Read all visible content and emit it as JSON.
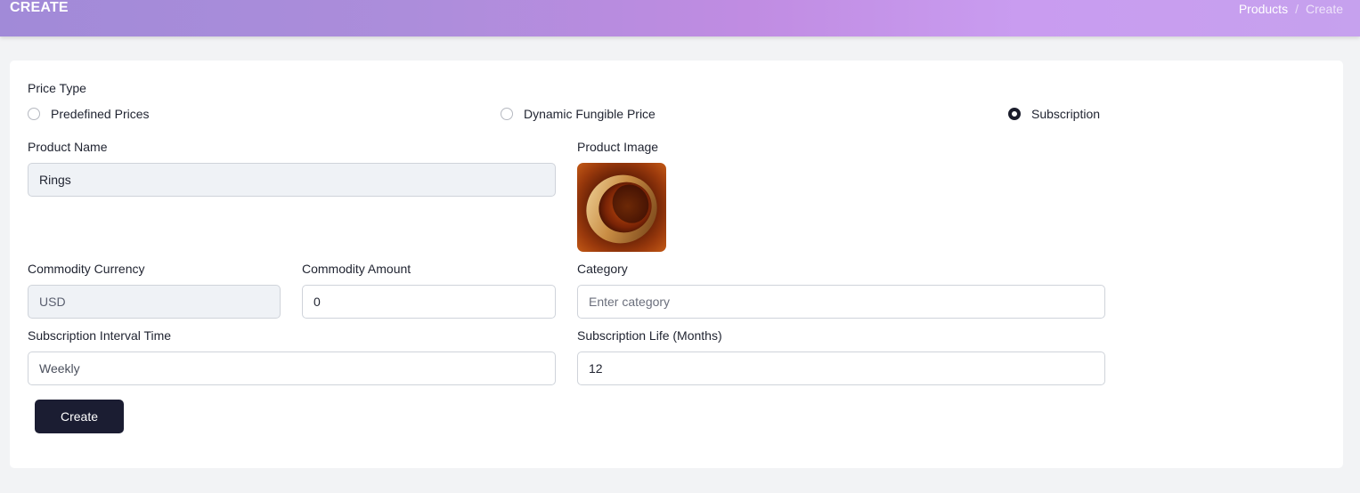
{
  "header": {
    "title": "CREATE",
    "breadcrumb": [
      "Products",
      "/",
      "Create"
    ]
  },
  "form": {
    "price_type": {
      "label": "Price Type",
      "options": [
        "Predefined Prices",
        "Dynamic Fungible Price",
        "Subscription"
      ],
      "selected": "Subscription"
    },
    "product_name": {
      "label": "Product Name",
      "value": "Rings"
    },
    "product_image": {
      "label": "Product Image",
      "icon": "ring-image"
    },
    "commodity_currency": {
      "label": "Commodity Currency",
      "value": "USD"
    },
    "commodity_amount": {
      "label": "Commodity Amount",
      "value": "0"
    },
    "category": {
      "label": "Category",
      "placeholder": "Enter category",
      "value": ""
    },
    "subscription_interval": {
      "label": "Subscription Interval Time",
      "value": "Weekly"
    },
    "subscription_life": {
      "label": "Subscription Life (Months)",
      "value": "12"
    },
    "submit_label": "Create"
  },
  "colors": {
    "accent_dark": "#1b1d32",
    "header_start": "#a18ad8",
    "header_end": "#c99cf0"
  }
}
